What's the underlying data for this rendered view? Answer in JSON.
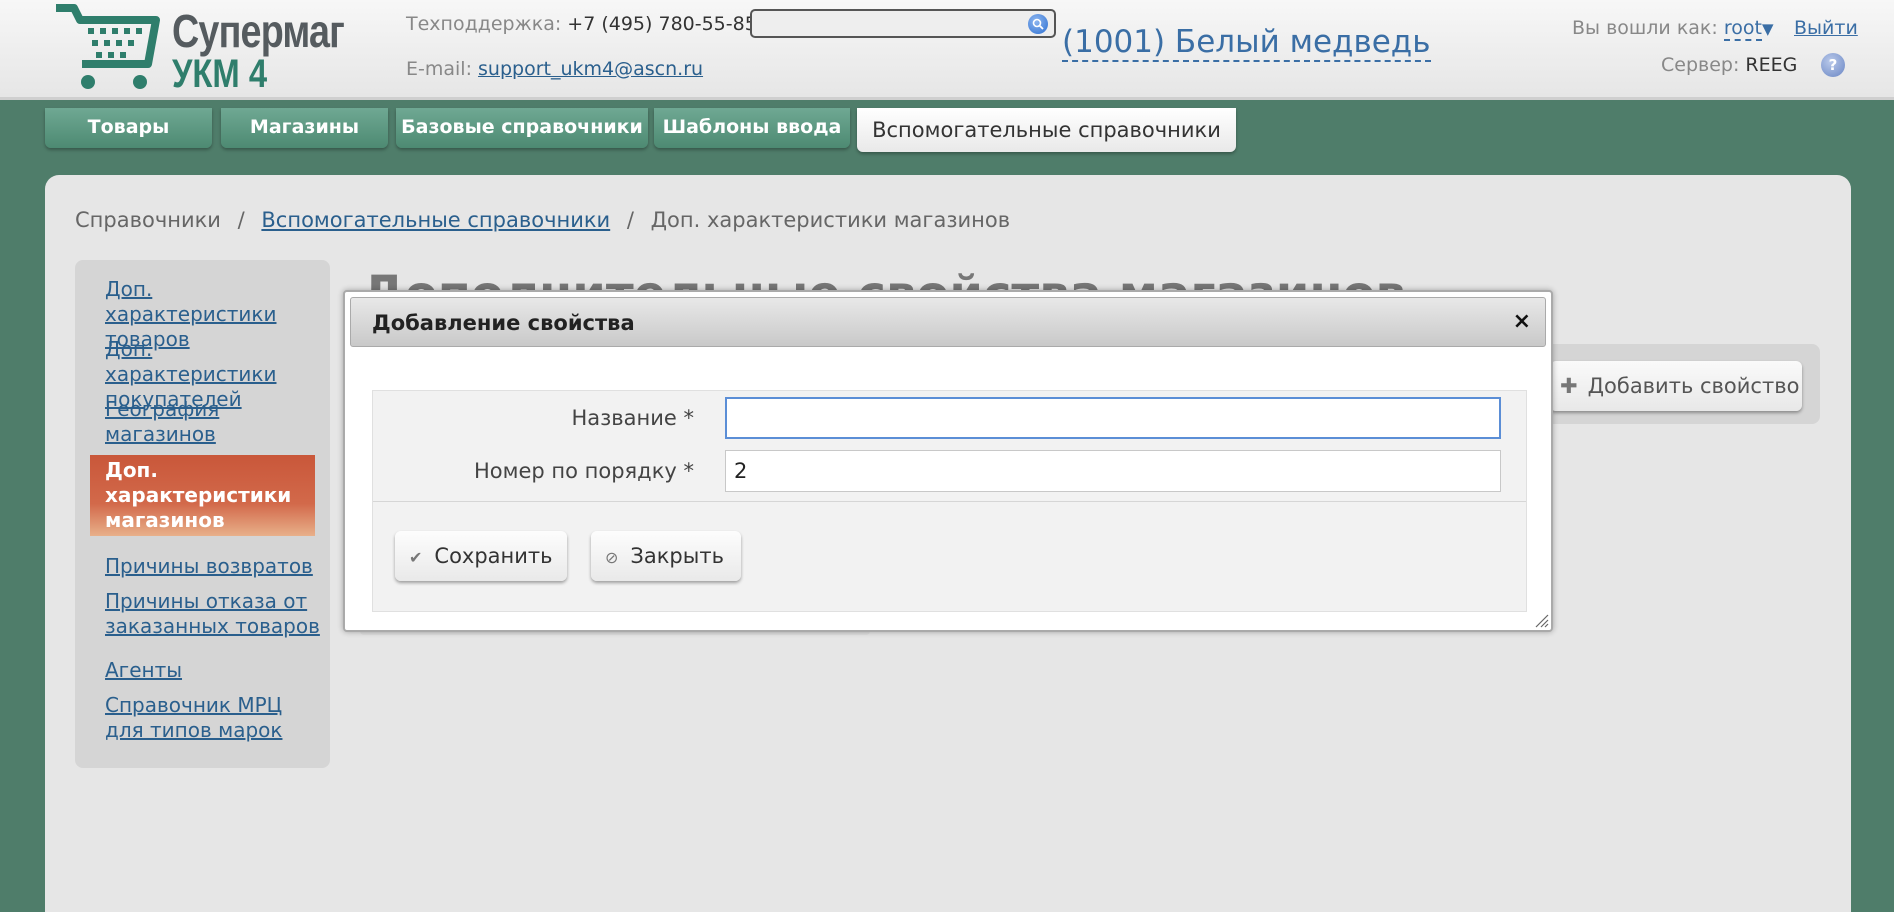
{
  "header": {
    "logo_line1": "Супермаг",
    "logo_line2": "УКМ 4",
    "support_label": "Техподдержка:",
    "support_phone": "+7 (495) 780-55-85",
    "email_label": "E-mail:",
    "email": "support_ukm4@ascn.ru",
    "search_value": "",
    "store": "(1001) Белый медведь",
    "login_label": "Вы вошли как:",
    "login_user": "root",
    "login_arrow": "▼",
    "logout": "Выйти",
    "server_label": "Сервер:",
    "server_name": "REEG",
    "help": "?"
  },
  "tabs": [
    {
      "label": "Товары"
    },
    {
      "label": "Магазины"
    },
    {
      "label": "Базовые справочники"
    },
    {
      "label": "Шаблоны ввода"
    },
    {
      "label": "Вспомогательные справочники",
      "active": true
    }
  ],
  "breadcrumb": {
    "root": "Справочники",
    "separator": "/",
    "parent": "Вспомогательные справочники",
    "current": "Доп. характеристики магазинов"
  },
  "sidebar": {
    "items": [
      {
        "label": "Доп. характеристики товаров"
      },
      {
        "label": "Доп. характеристики покупателей"
      },
      {
        "label": "География магазинов"
      },
      {
        "label": "Доп. характеристики магазинов",
        "active": true
      },
      {
        "label": "Причины возвратов"
      },
      {
        "label": "Причины отказа от заказанных товаров"
      },
      {
        "label": "Агенты"
      },
      {
        "label": "Справочник МРЦ для типов марок"
      }
    ]
  },
  "page": {
    "title": "Дополнительные свойства магазинов",
    "add_button": "Добавить свойство"
  },
  "dialog": {
    "title": "Добавление свойства",
    "close": "×",
    "fields": {
      "name_label": "Название *",
      "name_value": "",
      "order_label": "Номер по порядку *",
      "order_value": "2"
    },
    "save": "Сохранить",
    "cancel": "Закрыть"
  },
  "colors": {
    "background": "#4f7d6a",
    "tab": "#5d9a82",
    "active_sidebar": "#c9573a",
    "link": "#2a5f8d"
  }
}
